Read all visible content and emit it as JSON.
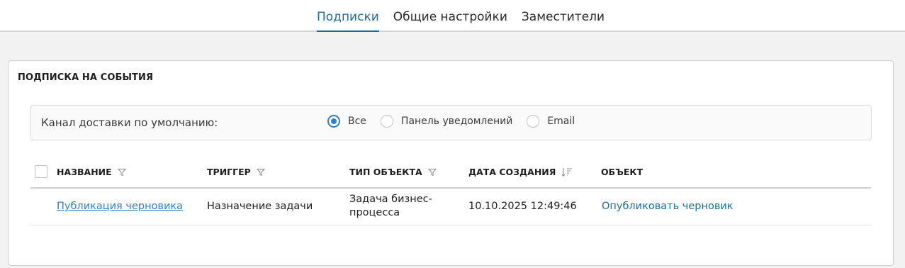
{
  "tabs": [
    {
      "label": "Подписки",
      "active": true
    },
    {
      "label": "Общие настройки",
      "active": false
    },
    {
      "label": "Заместители",
      "active": false
    }
  ],
  "card": {
    "title": "ПОДПИСКА НА СОБЫТИЯ",
    "channel_label": "Канал доставки по умолчанию:",
    "channel_options": [
      {
        "label": "Все",
        "selected": true
      },
      {
        "label": "Панель уведомлений",
        "selected": false
      },
      {
        "label": "Email",
        "selected": false
      }
    ]
  },
  "table": {
    "columns": [
      {
        "label": "НАЗВАНИЕ",
        "icon": "filter-icon"
      },
      {
        "label": "ТРИГГЕР",
        "icon": "filter-icon"
      },
      {
        "label": "ТИП ОБЪЕКТА",
        "icon": "filter-icon"
      },
      {
        "label": "ДАТА СОЗДАНИЯ",
        "icon": "sort-desc-icon"
      },
      {
        "label": "ОБЪЕКТ",
        "icon": ""
      }
    ],
    "rows": [
      {
        "name": "Публикация черновика",
        "trigger": "Назначение задачи",
        "object_type_line1": "Задача бизнес-",
        "object_type_line2": "процесса",
        "created": "10.10.2025 12:49:46",
        "object": "Опубликовать черновик"
      }
    ]
  },
  "colors": {
    "accent": "#1b6e9e",
    "radio": "#2f7fd1",
    "background": "#f2f2f2"
  }
}
